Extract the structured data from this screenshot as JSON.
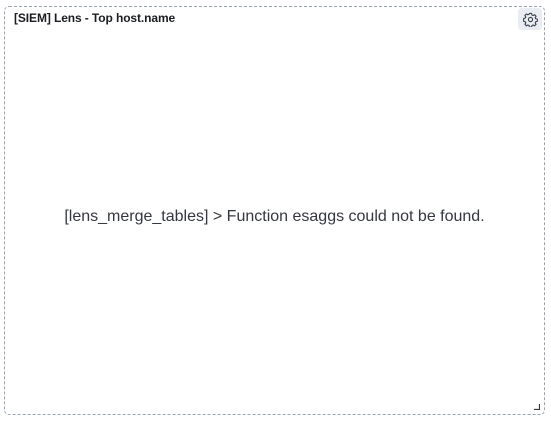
{
  "panel": {
    "title": "[SIEM] Lens - Top host.name",
    "options_icon": "gear-icon",
    "error_message": "[lens_merge_tables] > Function esaggs could not be found.",
    "resize_icon": "resize-corner-icon"
  },
  "colors": {
    "border": "#98a2b3",
    "title_text": "#1a1c21",
    "message_text": "#343741",
    "options_button_bg": "#e9edf3"
  }
}
